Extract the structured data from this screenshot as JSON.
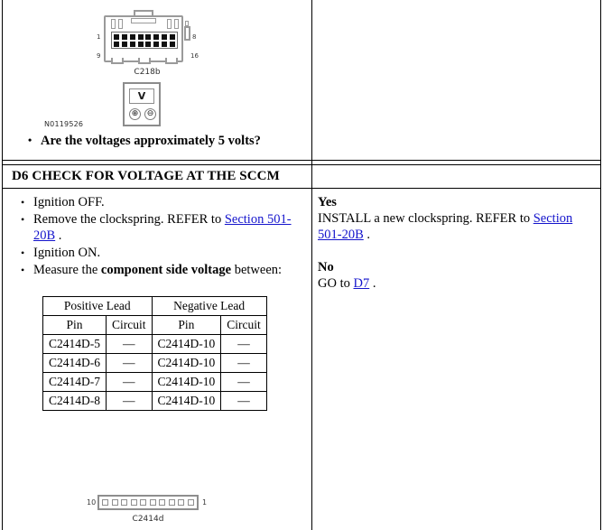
{
  "top_cell": {
    "connector": {
      "caption": "C218b",
      "pin_labels": {
        "top_left": "1",
        "bottom_left": "9",
        "top_right": "8",
        "bottom_right": "16"
      },
      "pins_per_row": 8,
      "rows": 2
    },
    "meter": {
      "display": "V",
      "positive_terminal": "⊕",
      "negative_terminal": "⊖"
    },
    "figure_id": "N0119526",
    "question": "Are the voltages approximately 5 volts?"
  },
  "step": {
    "header": "D6 CHECK FOR VOLTAGE AT THE SCCM",
    "instructions": [
      {
        "text_before": "Ignition OFF.",
        "link": "",
        "text_after": ""
      },
      {
        "text_before": "Remove the clockspring. REFER to ",
        "link": "Section 501-20B",
        "text_after": " ."
      },
      {
        "text_before": "Ignition ON.",
        "link": "",
        "text_after": ""
      },
      {
        "text_before": "Measure the ",
        "bold": "component side voltage",
        "text_after": " between:"
      }
    ]
  },
  "measure_table": {
    "group_headers": [
      "Positive Lead",
      "Negative Lead"
    ],
    "column_headers": [
      "Pin",
      "Circuit",
      "Pin",
      "Circuit"
    ],
    "rows": [
      [
        "C2414D-5",
        "—",
        "C2414D-10",
        "—"
      ],
      [
        "C2414D-6",
        "—",
        "C2414D-10",
        "—"
      ],
      [
        "C2414D-7",
        "—",
        "C2414D-10",
        "—"
      ],
      [
        "C2414D-8",
        "—",
        "C2414D-10",
        "—"
      ]
    ]
  },
  "bottom_connector": {
    "caption": "C2414d",
    "left_label": "10",
    "right_label": "1",
    "pin_count": 10
  },
  "answers": {
    "yes_label": "Yes",
    "yes_before": "INSTALL a new clockspring. REFER to ",
    "yes_link": "Section 501-20B",
    "yes_after": " .",
    "no_label": "No",
    "no_before": "GO to ",
    "no_link": "D7",
    "no_after": " ."
  },
  "colors": {
    "link": "#1414cc",
    "text": "#000000",
    "border": "#000000",
    "artwork_gray": "#8e8e8e"
  }
}
